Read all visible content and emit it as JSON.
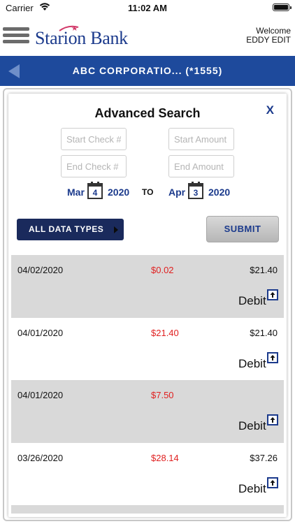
{
  "status_bar": {
    "carrier": "Carrier",
    "time": "11:02 AM"
  },
  "header": {
    "logo_text": "Starion Bank",
    "welcome": "Welcome",
    "user": "EDDY EDIT"
  },
  "account": {
    "title": "ABC CORPORATIO...  (*1555)"
  },
  "search": {
    "title": "Advanced Search",
    "close_label": "X",
    "start_check_placeholder": "Start Check #",
    "end_check_placeholder": "End Check #",
    "start_amount_placeholder": "Start Amount",
    "end_amount_placeholder": "End Amount",
    "from_month": "Mar",
    "from_day": "4",
    "from_year": "2020",
    "to_label": "TO",
    "to_month": "Apr",
    "to_day": "3",
    "to_year": "2020",
    "types_label": "ALL DATA TYPES",
    "submit_label": "SUBMIT"
  },
  "transactions": [
    {
      "date": "04/02/2020",
      "amount": "$0.02",
      "balance": "$21.40",
      "type": "Debit"
    },
    {
      "date": "04/01/2020",
      "amount": "$21.40",
      "balance": "$21.40",
      "type": "Debit"
    },
    {
      "date": "04/01/2020",
      "amount": "$7.50",
      "balance": "",
      "type": "Debit"
    },
    {
      "date": "03/26/2020",
      "amount": "$28.14",
      "balance": "$37.26",
      "type": "Debit"
    }
  ],
  "icons": {
    "menu": "hamburger-icon",
    "back": "back-arrow-icon",
    "calendar": "calendar-icon",
    "upload": "arrow-up-box-icon"
  },
  "colors": {
    "brand_blue": "#1e4a9c",
    "amount_red": "#e02020",
    "types_button": "#1a2a5c"
  }
}
